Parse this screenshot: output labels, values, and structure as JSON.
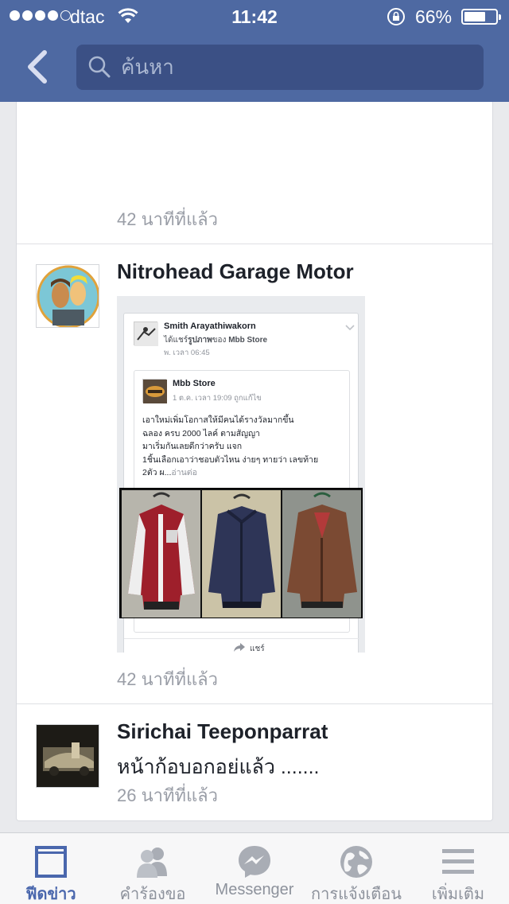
{
  "status_bar": {
    "carrier": "dtac",
    "time": "11:42",
    "battery": "66%"
  },
  "nav": {
    "search_placeholder": "ค้นหา"
  },
  "feed": {
    "top_post": {
      "time_ago": "42 นาทีที่แล้ว"
    },
    "post_nitro": {
      "author": "Nitrohead Garage Motor",
      "time_ago": "42 นาทีที่แล้ว",
      "shared_screenshot": {
        "sharer_name": "Smith Arayathiwakorn",
        "shared_action_prefix": "ได้แชร์",
        "shared_action_object": "รูปภาพ",
        "shared_action_mid": "ของ",
        "shared_page": "Mbb Store",
        "sharer_meta": "พ. เวลา 06:45",
        "page_name": "Mbb Store",
        "page_meta": "1 ต.ค. เวลา 19:09 ถูกแก้ไข",
        "body_lines": [
          "เอาใหม่เพิ่มโอกาสให้มีคนได้รางวัลมากขึ้น",
          "ฉลอง ครบ 2000 ไลค์ ตามสัญญา",
          "มาเริ่มกันเลยดีกว่าครับ แจก",
          "1ชิ้นเลือกเอาว่าชอบตัวไหน ง่ายๆ ทายว่า เลขท้าย"
        ],
        "body_last_line": "2ตัว ผ...",
        "read_more": "อ่านต่อ",
        "share_label": "แชร์"
      }
    },
    "post_sirichai": {
      "author": "Sirichai Teeponparrat",
      "text": "หน้าก้อบอกอย่แล้ว .......",
      "time_ago": "26 นาทีที่แล้ว"
    }
  },
  "tabs": [
    {
      "label": "ฟีดข่าว",
      "icon": "news-feed-icon",
      "active": true
    },
    {
      "label": "คำร้องขอ",
      "icon": "friend-requests-icon",
      "active": false
    },
    {
      "label": "Messenger",
      "icon": "messenger-icon",
      "active": false
    },
    {
      "label": "การแจ้งเตือน",
      "icon": "globe-icon",
      "active": false
    },
    {
      "label": "เพิ่มเติม",
      "icon": "menu-icon",
      "active": false
    }
  ],
  "colors": {
    "header": "#4e69a2",
    "search_bg": "#3b5085",
    "active_tab": "#4a67ad",
    "inactive_tab": "#8d929c"
  }
}
